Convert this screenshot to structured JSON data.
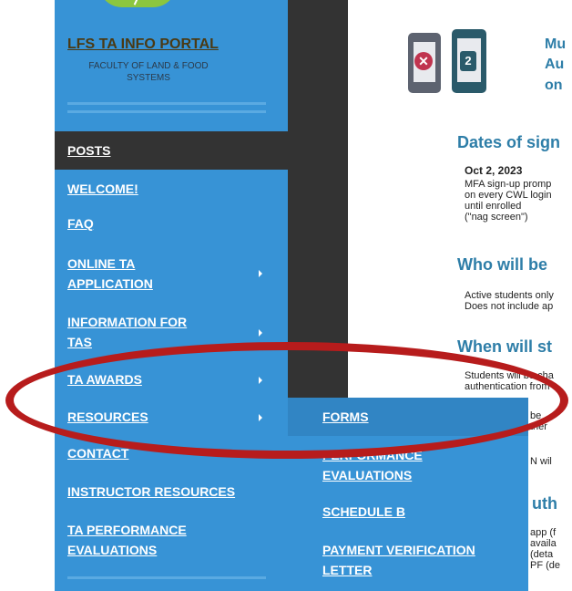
{
  "portal": {
    "title": "LFS TA INFO PORTAL",
    "subtitle": "FACULTY OF LAND & FOOD SYSTEMS"
  },
  "menu": {
    "posts": "POSTS",
    "welcome": "WELCOME!",
    "faq": "FAQ",
    "online_ta_application_1": "ONLINE TA",
    "online_ta_application_2": "APPLICATION",
    "information_for_tas_1": "INFORMATION FOR",
    "information_for_tas_2": "TAS",
    "ta_awards": "TA AWARDS",
    "resources": "RESOURCES",
    "contact": "CONTACT",
    "instructor_resources": "INSTRUCTOR RESOURCES",
    "ta_performance_evaluations_1": "TA PERFORMANCE",
    "ta_performance_evaluations_2": "EVALUATIONS"
  },
  "submenu": {
    "forms": "FORMS",
    "performance_evaluations_1": "PERFORMANCE",
    "performance_evaluations_2": "EVALUATIONS",
    "schedule_b": "SCHEDULE B",
    "payment_verification_letter_1": "PAYMENT VERIFICATION",
    "payment_verification_letter_2": "LETTER"
  },
  "content": {
    "header_1": "Mu",
    "header_2": "Au",
    "header_3": "on",
    "phone_icon_number": "2",
    "dates_heading": "Dates of sign",
    "date": "Oct 2, 2023",
    "date_line_1": "MFA sign-up promp",
    "date_line_2": "on every CWL login",
    "date_line_3": "until enrolled",
    "date_line_4": "(\"nag screen\")",
    "who_heading": "Who will be",
    "who_line_1": "Active students only",
    "who_line_2": "Does not include ap",
    "when_heading": "When will st",
    "when_line_1": "Students will be cha",
    "when_line_2": "authentication from",
    "partial_1": "be",
    "partial_2": "ther",
    "partial_3": "N wil",
    "partial_heading": "uth",
    "partial_4": "app (f",
    "partial_5": "availa",
    "partial_6": "(deta",
    "partial_7": "PF (de"
  },
  "colors": {
    "sidebar": "#3793d6",
    "dark": "#333333",
    "highlight_ellipse": "#b71c1c",
    "heading": "#2e7ea8"
  }
}
